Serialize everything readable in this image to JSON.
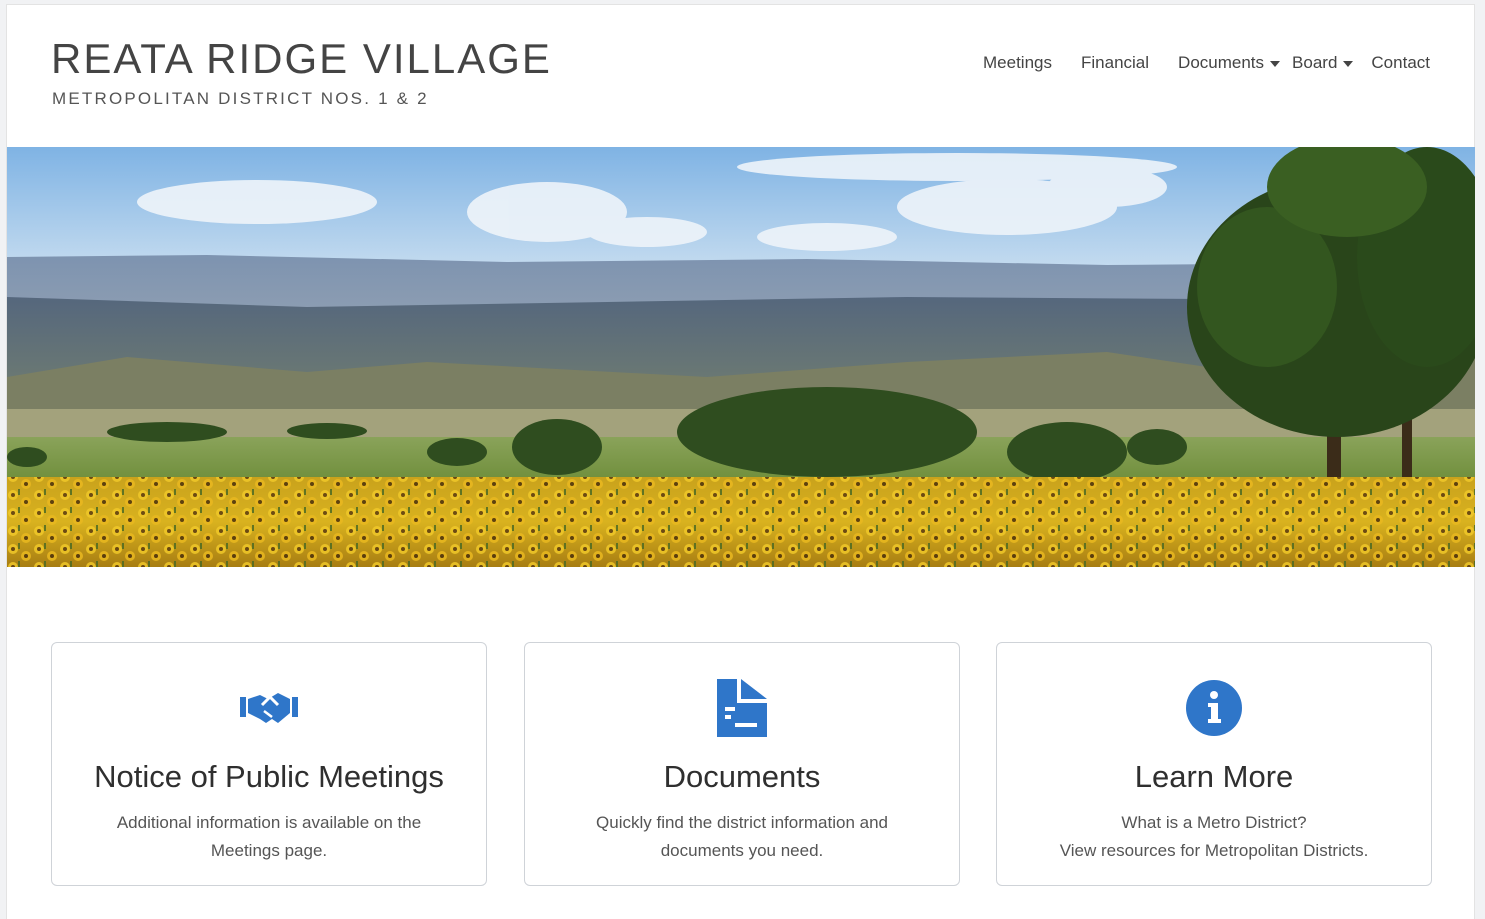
{
  "header": {
    "title": "REATA RIDGE VILLAGE",
    "subtitle": "METROPOLITAN DISTRICT NOS. 1 & 2"
  },
  "nav": {
    "meetings": "Meetings",
    "financial": "Financial",
    "documents": "Documents",
    "board": "Board",
    "contact": "Contact"
  },
  "hero": {
    "image": "sunflower-field-landscape"
  },
  "cards": [
    {
      "icon": "handshake-icon",
      "title": "Notice of Public Meetings",
      "line1": "Additional information is available on the",
      "line2": "Meetings page."
    },
    {
      "icon": "document-icon",
      "title": "Documents",
      "line1": "Quickly find the district information and",
      "line2": "documents you need."
    },
    {
      "icon": "info-circle-icon",
      "title": "Learn More",
      "line1": "What is a Metro District?",
      "line2": "View resources for Metropolitan Districts."
    }
  ],
  "colors": {
    "accent": "#2f76c9",
    "text": "#444444"
  }
}
